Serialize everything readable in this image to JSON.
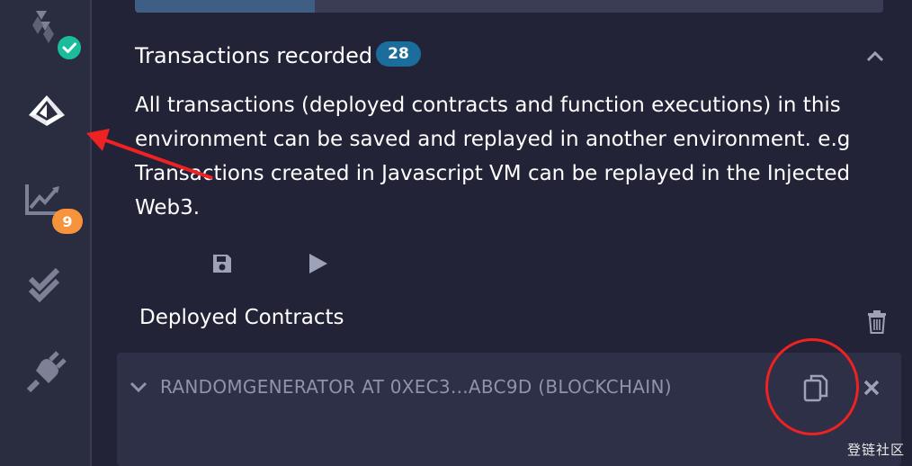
{
  "transactions": {
    "title": "Transactions recorded",
    "count": "28",
    "description": "All transactions (deployed contracts and function executions) in this environment can be saved and replayed in another environment. e.g Transactions created in Javascript VM can be replayed in the Injected Web3."
  },
  "deployed": {
    "title": "Deployed Contracts",
    "contract_label": "RANDOMGENERATOR AT 0XEC3...ABC9D (BLOCKCHAIN)"
  },
  "rail": {
    "analysis_badge": "9",
    "icons": [
      "solidity-compiler-icon",
      "deploy-run-icon",
      "analysis-icon",
      "test-icon",
      "plugin-icon"
    ]
  },
  "watermark": "登链社区",
  "colors": {
    "background": "#222336",
    "rail": "#2a2c3f",
    "count_pill": "#1b6d9c",
    "badge_orange": "#f7933c",
    "badge_green": "#1bbc9b",
    "annotation_red": "#ee2222"
  }
}
